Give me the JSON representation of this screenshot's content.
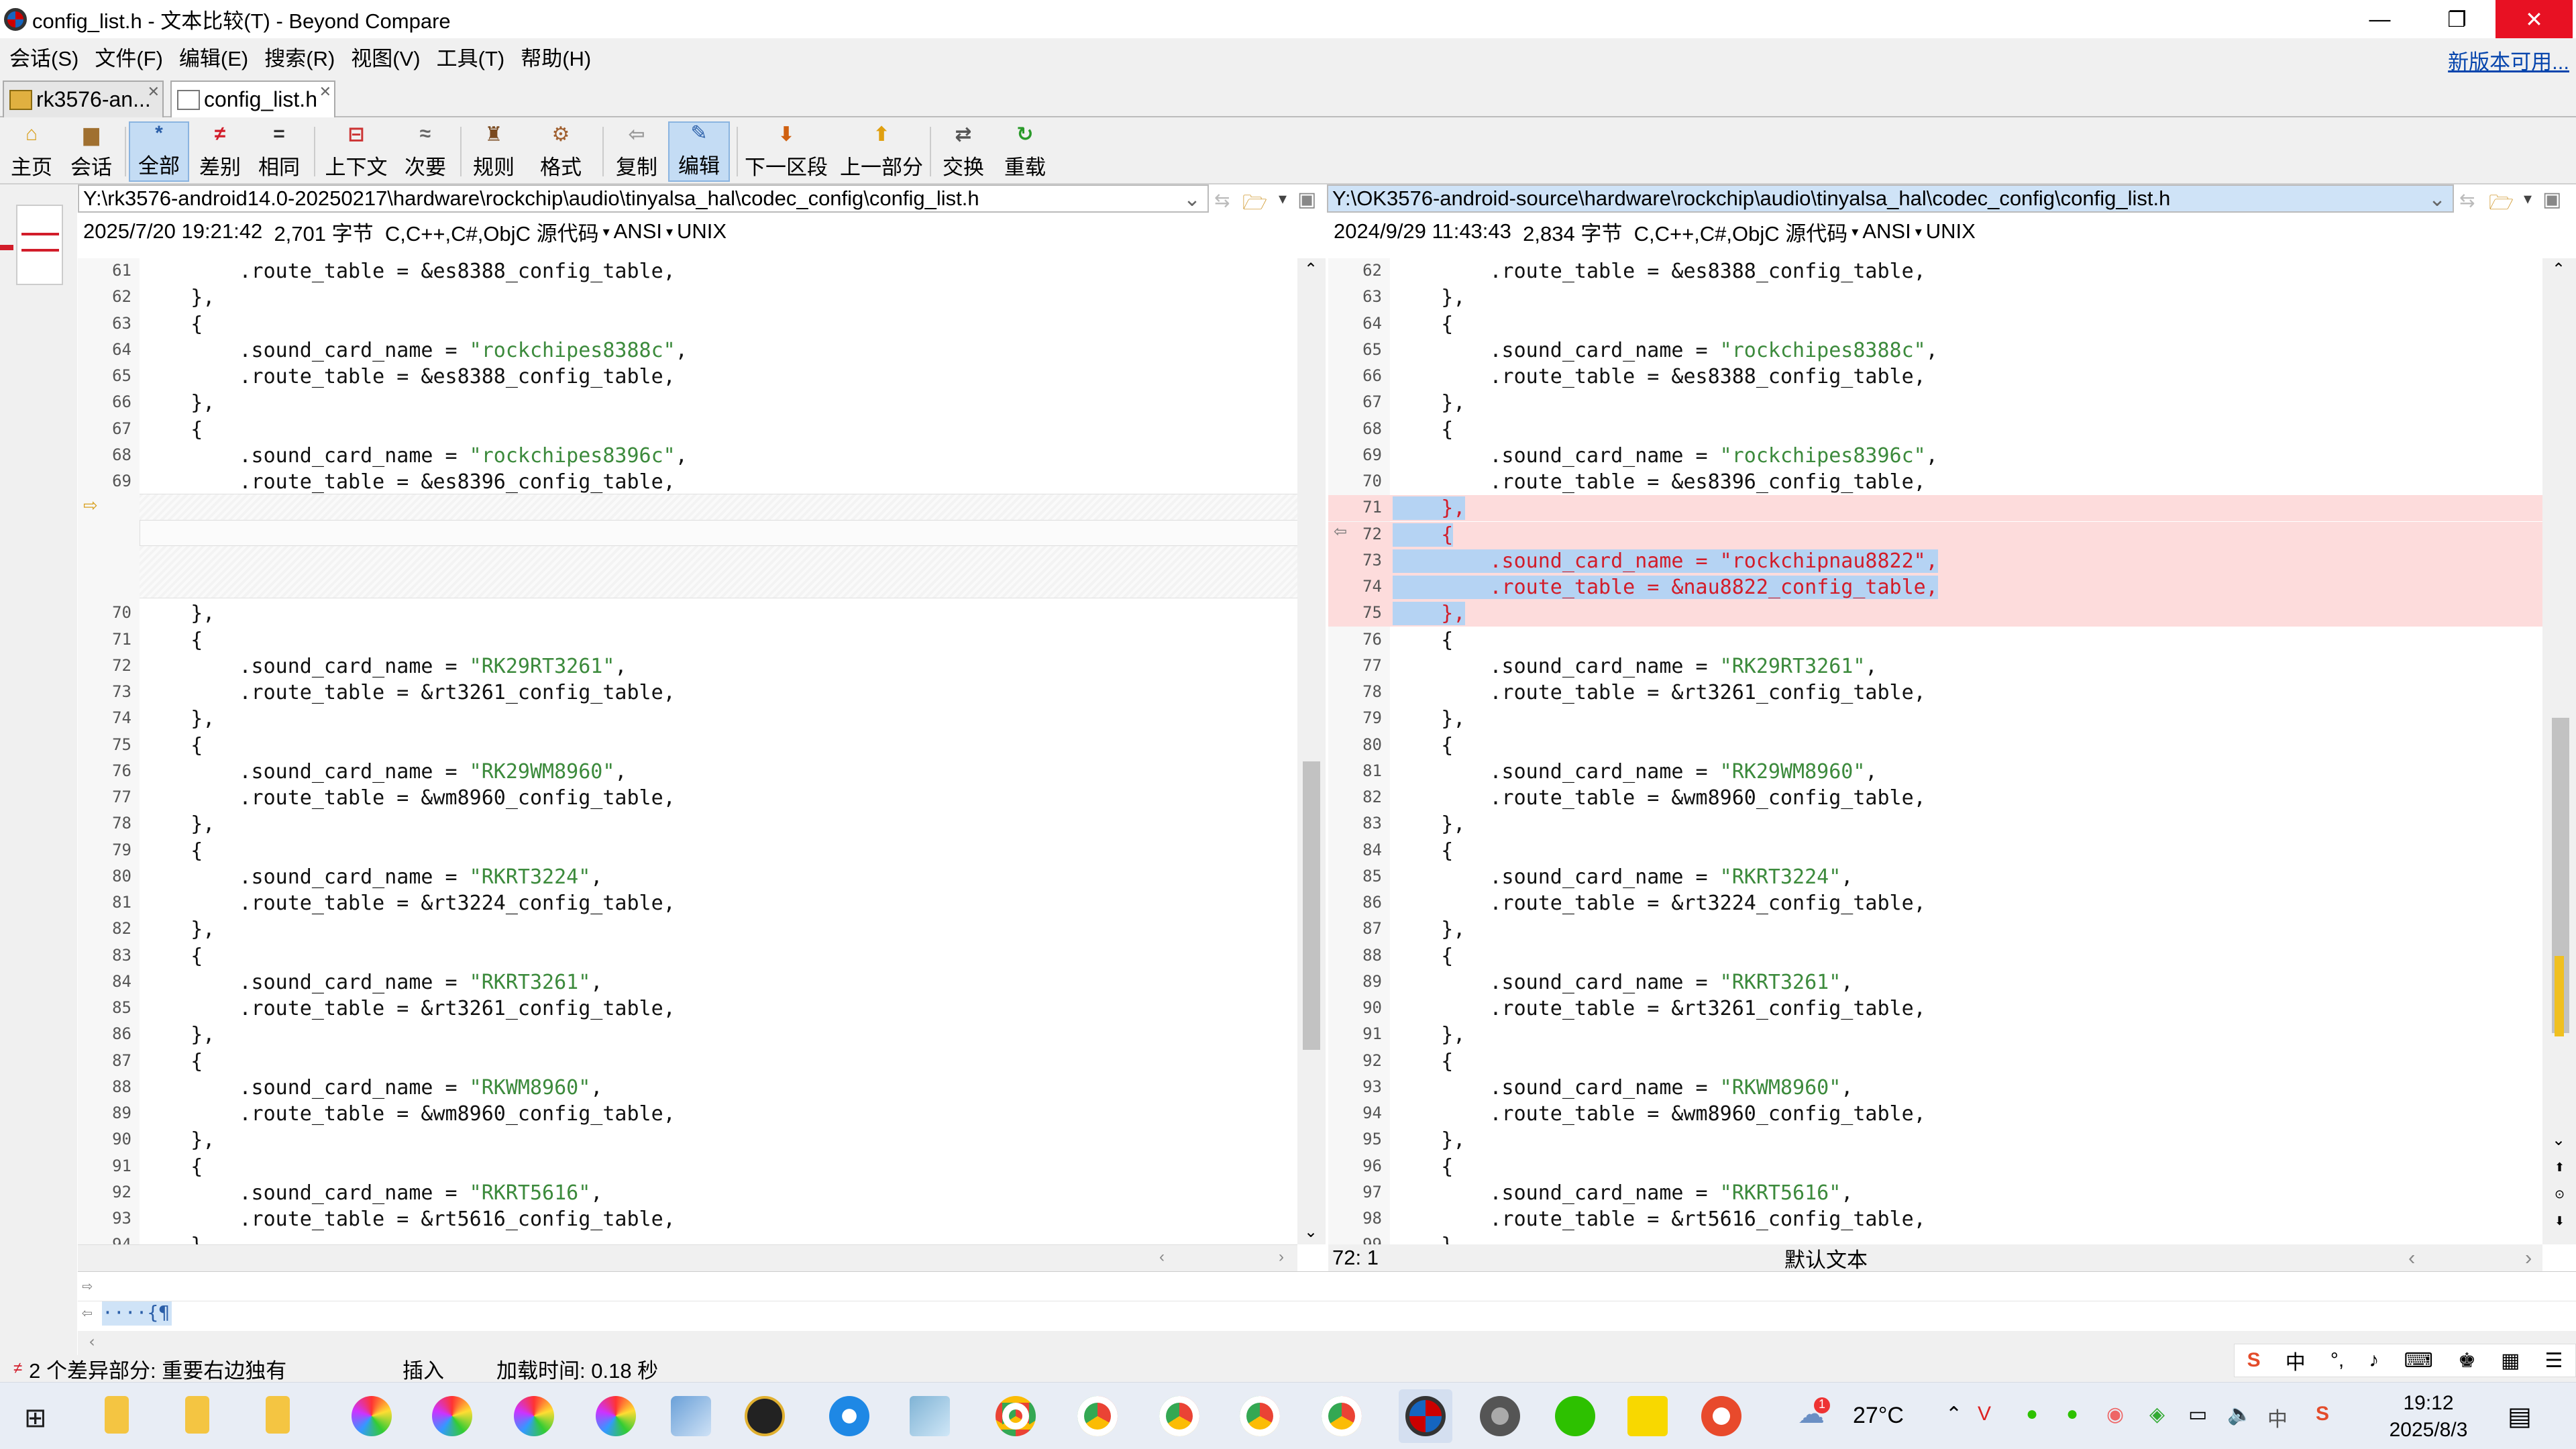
{
  "window": {
    "title": "config_list.h - 文本比较(T) - Beyond Compare",
    "minimize_icon": "minimize-icon",
    "maximize_icon": "restore-icon",
    "close_icon": "close-icon"
  },
  "menu": {
    "items": [
      "会话(S)",
      "文件(F)",
      "编辑(E)",
      "搜索(R)",
      "视图(V)",
      "工具(T)",
      "帮助(H)"
    ],
    "new_version": "新版本可用..."
  },
  "tabs": [
    {
      "label": "rk3576-an...",
      "active": false
    },
    {
      "label": "config_list.h",
      "active": true
    }
  ],
  "toolbar": {
    "buttons": [
      {
        "label": "主页",
        "icon": "home-icon"
      },
      {
        "label": "会话",
        "icon": "session-icon"
      },
      {
        "label": "全部",
        "icon": "all-icon",
        "active": true
      },
      {
        "label": "差别",
        "icon": "diff-icon"
      },
      {
        "label": "相同",
        "icon": "same-icon"
      },
      {
        "label": "上下文",
        "icon": "context-icon"
      },
      {
        "label": "次要",
        "icon": "minor-icon"
      },
      {
        "label": "规则",
        "icon": "rules-icon"
      },
      {
        "label": "格式",
        "icon": "format-icon"
      },
      {
        "label": "复制",
        "icon": "copy-icon"
      },
      {
        "label": "编辑",
        "icon": "edit-icon",
        "active": true
      },
      {
        "label": "下一区段",
        "icon": "next-section-icon"
      },
      {
        "label": "上一部分",
        "icon": "prev-section-icon"
      },
      {
        "label": "交换",
        "icon": "swap-icon"
      },
      {
        "label": "重载",
        "icon": "reload-icon"
      }
    ]
  },
  "left": {
    "path": "Y:\\rk3576-android14.0-20250217\\hardware\\rockchip\\audio\\tinyalsa_hal\\codec_config\\config_list.h",
    "date": "2025/7/20 19:21:42",
    "size": "2,701 字节",
    "lang": "C,C++,C#,ObjC 源代码",
    "encoding": "ANSI",
    "eol": "UNIX",
    "lines_top": [
      {
        "n": "61",
        "t": "        .route_table = &es8388_config_table,"
      },
      {
        "n": "62",
        "t": "    },"
      },
      {
        "n": "63",
        "t": "    {"
      },
      {
        "n": "64",
        "t": "        .sound_card_name = ",
        "s": "\"rockchipes8388c\"",
        "e": ","
      },
      {
        "n": "65",
        "t": "        .route_table = &es8388_config_table,"
      },
      {
        "n": "66",
        "t": "    },"
      },
      {
        "n": "67",
        "t": "    {"
      },
      {
        "n": "68",
        "t": "        .sound_card_name = ",
        "s": "\"rockchipes8396c\"",
        "e": ","
      },
      {
        "n": "69",
        "t": "        .route_table = &es8396_config_table,"
      }
    ],
    "lines_bottom": [
      {
        "n": "70",
        "t": "    },"
      },
      {
        "n": "71",
        "t": "    {"
      },
      {
        "n": "72",
        "t": "        .sound_card_name = ",
        "s": "\"RK29RT3261\"",
        "e": ","
      },
      {
        "n": "73",
        "t": "        .route_table = &rt3261_config_table,"
      },
      {
        "n": "74",
        "t": "    },"
      },
      {
        "n": "75",
        "t": "    {"
      },
      {
        "n": "76",
        "t": "        .sound_card_name = ",
        "s": "\"RK29WM8960\"",
        "e": ","
      },
      {
        "n": "77",
        "t": "        .route_table = &wm8960_config_table,"
      },
      {
        "n": "78",
        "t": "    },"
      },
      {
        "n": "79",
        "t": "    {"
      },
      {
        "n": "80",
        "t": "        .sound_card_name = ",
        "s": "\"RKRT3224\"",
        "e": ","
      },
      {
        "n": "81",
        "t": "        .route_table = &rt3224_config_table,"
      },
      {
        "n": "82",
        "t": "    },"
      },
      {
        "n": "83",
        "t": "    {"
      },
      {
        "n": "84",
        "t": "        .sound_card_name = ",
        "s": "\"RKRT3261\"",
        "e": ","
      },
      {
        "n": "85",
        "t": "        .route_table = &rt3261_config_table,"
      },
      {
        "n": "86",
        "t": "    },"
      },
      {
        "n": "87",
        "t": "    {"
      },
      {
        "n": "88",
        "t": "        .sound_card_name = ",
        "s": "\"RKWM8960\"",
        "e": ","
      },
      {
        "n": "89",
        "t": "        .route_table = &wm8960_config_table,"
      },
      {
        "n": "90",
        "t": "    },"
      },
      {
        "n": "91",
        "t": "    {"
      },
      {
        "n": "92",
        "t": "        .sound_card_name = ",
        "s": "\"RKRT5616\"",
        "e": ","
      },
      {
        "n": "93",
        "t": "        .route_table = &rt5616_config_table,"
      },
      {
        "n": "94",
        "t": "    },"
      }
    ]
  },
  "right": {
    "path": "Y:\\OK3576-android-source\\hardware\\rockchip\\audio\\tinyalsa_hal\\codec_config\\config_list.h",
    "date": "2024/9/29 11:43:43",
    "size": "2,834 字节",
    "lang": "C,C++,C#,ObjC 源代码",
    "encoding": "ANSI",
    "eol": "UNIX",
    "lines": [
      {
        "n": "62",
        "t": "        .route_table = &es8388_config_table,"
      },
      {
        "n": "63",
        "t": "    },"
      },
      {
        "n": "64",
        "t": "    {"
      },
      {
        "n": "65",
        "t": "        .sound_card_name = ",
        "s": "\"rockchipes8388c\"",
        "e": ","
      },
      {
        "n": "66",
        "t": "        .route_table = &es8388_config_table,"
      },
      {
        "n": "67",
        "t": "    },"
      },
      {
        "n": "68",
        "t": "    {"
      },
      {
        "n": "69",
        "t": "        .sound_card_name = ",
        "s": "\"rockchipes8396c\"",
        "e": ","
      },
      {
        "n": "70",
        "t": "        .route_table = &es8396_config_table,"
      },
      {
        "n": "71",
        "t": "    },",
        "diff": true
      },
      {
        "n": "72",
        "t": "    {",
        "diff": true
      },
      {
        "n": "73",
        "t": "        .sound_card_name = \"rockchipnau8822\",",
        "diff": true
      },
      {
        "n": "74",
        "t": "        .route_table = &nau8822_config_table,",
        "diff": true
      },
      {
        "n": "75",
        "t": "    },",
        "diff": true
      },
      {
        "n": "76",
        "t": "    {"
      },
      {
        "n": "77",
        "t": "        .sound_card_name = ",
        "s": "\"RK29RT3261\"",
        "e": ","
      },
      {
        "n": "78",
        "t": "        .route_table = &rt3261_config_table,"
      },
      {
        "n": "79",
        "t": "    },"
      },
      {
        "n": "80",
        "t": "    {"
      },
      {
        "n": "81",
        "t": "        .sound_card_name = ",
        "s": "\"RK29WM8960\"",
        "e": ","
      },
      {
        "n": "82",
        "t": "        .route_table = &wm8960_config_table,"
      },
      {
        "n": "83",
        "t": "    },"
      },
      {
        "n": "84",
        "t": "    {"
      },
      {
        "n": "85",
        "t": "        .sound_card_name = ",
        "s": "\"RKRT3224\"",
        "e": ","
      },
      {
        "n": "86",
        "t": "        .route_table = &rt3224_config_table,"
      },
      {
        "n": "87",
        "t": "    },"
      },
      {
        "n": "88",
        "t": "    {"
      },
      {
        "n": "89",
        "t": "        .sound_card_name = ",
        "s": "\"RKRT3261\"",
        "e": ","
      },
      {
        "n": "90",
        "t": "        .route_table = &rt3261_config_table,"
      },
      {
        "n": "91",
        "t": "    },"
      },
      {
        "n": "92",
        "t": "    {"
      },
      {
        "n": "93",
        "t": "        .sound_card_name = ",
        "s": "\"RKWM8960\"",
        "e": ","
      },
      {
        "n": "94",
        "t": "        .route_table = &wm8960_config_table,"
      },
      {
        "n": "95",
        "t": "    },"
      },
      {
        "n": "96",
        "t": "    {"
      },
      {
        "n": "97",
        "t": "        .sound_card_name = ",
        "s": "\"RKRT5616\"",
        "e": ","
      },
      {
        "n": "98",
        "t": "        .route_table = &rt5616_config_table,"
      },
      {
        "n": "99",
        "t": "    },"
      }
    ]
  },
  "position": {
    "cursor": "72: 1",
    "mode": "默认文本"
  },
  "lower_pane": {
    "line2": "····{¶"
  },
  "status": {
    "diffs": "2 个差异部分: 重要右边独有",
    "insert": "插入",
    "load_time": "加载时间: 0.18 秒"
  },
  "taskbar": {
    "weather": "27°C",
    "time": "19:12",
    "date": "2025/8/3",
    "ime": "中",
    "notification_badge": "1"
  },
  "colors": {
    "diff_bg": "#fddcdc",
    "diff_text": "#d21d2a",
    "selection": "#b5d3f3",
    "string": "#3c8a3c",
    "active_button": "#c4dcf4"
  }
}
